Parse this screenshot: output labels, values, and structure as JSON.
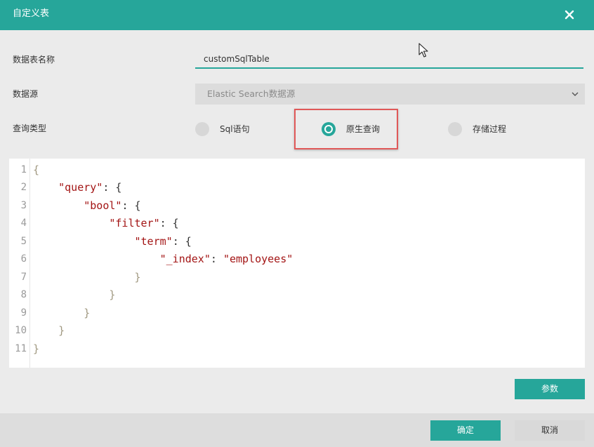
{
  "dialog": {
    "title": "自定义表",
    "close_icon": "close-icon"
  },
  "form": {
    "name_label": "数据表名称",
    "name_value": "customSqlTable",
    "source_label": "数据源",
    "source_value": "Elastic Search数据源",
    "query_type_label": "查询类型",
    "query_types": [
      {
        "label": "Sql语句",
        "checked": false
      },
      {
        "label": "原生查询",
        "checked": true
      },
      {
        "label": "存储过程",
        "checked": false
      }
    ]
  },
  "editor": {
    "line_numbers": [
      "1",
      "2",
      "3",
      "4",
      "5",
      "6",
      "7",
      "8",
      "9",
      "10",
      "11"
    ],
    "lines": [
      {
        "indent": "",
        "key": "",
        "rest": "{"
      },
      {
        "indent": "    ",
        "key": "\"query\"",
        "rest": ": {"
      },
      {
        "indent": "        ",
        "key": "\"bool\"",
        "rest": ": {"
      },
      {
        "indent": "            ",
        "key": "\"filter\"",
        "rest": ": {"
      },
      {
        "indent": "                ",
        "key": "\"term\"",
        "rest": ": {"
      },
      {
        "indent": "                    ",
        "key": "\"_index\"",
        "rest": ": ",
        "value": "\"employees\""
      },
      {
        "indent": "                ",
        "key": "",
        "rest": "}"
      },
      {
        "indent": "            ",
        "key": "",
        "rest": "}"
      },
      {
        "indent": "        ",
        "key": "",
        "rest": "}"
      },
      {
        "indent": "    ",
        "key": "",
        "rest": "}"
      },
      {
        "indent": "",
        "key": "",
        "rest": "}"
      }
    ]
  },
  "buttons": {
    "params": "参数",
    "ok": "确定",
    "cancel": "取消"
  },
  "colors": {
    "accent": "#26a69a",
    "highlight": "#e05858"
  }
}
